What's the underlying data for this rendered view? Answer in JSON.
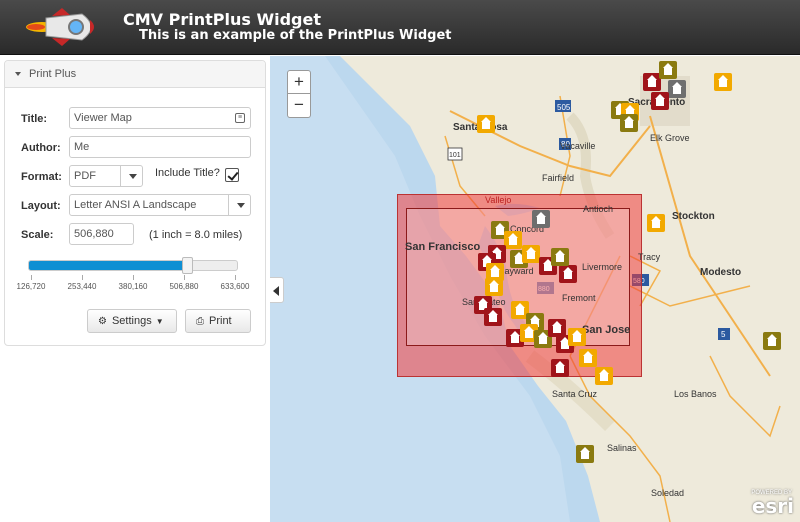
{
  "header": {
    "title": "CMV PrintPlus Widget",
    "subtitle": "This is an example of the PrintPlus Widget",
    "logo_icon": "rocket-icon"
  },
  "panel": {
    "heading": "Print Plus",
    "title_label": "Title:",
    "title_value": "Viewer Map",
    "author_label": "Author:",
    "author_value": "Me",
    "format_label": "Format:",
    "format_value": "PDF",
    "include_title_label": "Include Title?",
    "include_title_checked": true,
    "layout_label": "Layout:",
    "layout_value": "Letter ANSI A Landscape",
    "scale_label": "Scale:",
    "scale_value": "506,880",
    "scale_note": "(1 inch = 8.0 miles)",
    "slider": {
      "ticks": [
        "126,720",
        "253,440",
        "380,160",
        "506,880",
        "633,600"
      ],
      "value_fraction": 0.75
    },
    "settings_button": "Settings",
    "print_button": "Print"
  },
  "map": {
    "zoom_in": "+",
    "zoom_out": "−",
    "cities": {
      "santa_rosa": "Santa Rosa",
      "sacramento": "Sacramento",
      "elk_grove": "Elk Grove",
      "vacaville": "Vacaville",
      "fairfield": "Fairfield",
      "vallejo": "Vallejo",
      "antioch": "Antioch",
      "concord": "Concord",
      "stockton": "Stockton",
      "san_francisco": "San Francisco",
      "san_mateo": "San Mateo",
      "livermore": "Livermore",
      "tracy": "Tracy",
      "fremont": "Fremont",
      "modesto": "Modesto",
      "san_jose": "San Jose",
      "santa_cruz": "Santa Cruz",
      "los_banos": "Los Banos",
      "salinas": "Salinas",
      "soledad": "Soledad",
      "hayward": "Hayward"
    },
    "shields": {
      "i505": "505",
      "i80": "80",
      "i880": "880",
      "i580": "580",
      "r101": "101",
      "r5": "5"
    },
    "attribution_small": "POWERED BY",
    "attribution": "esri"
  }
}
